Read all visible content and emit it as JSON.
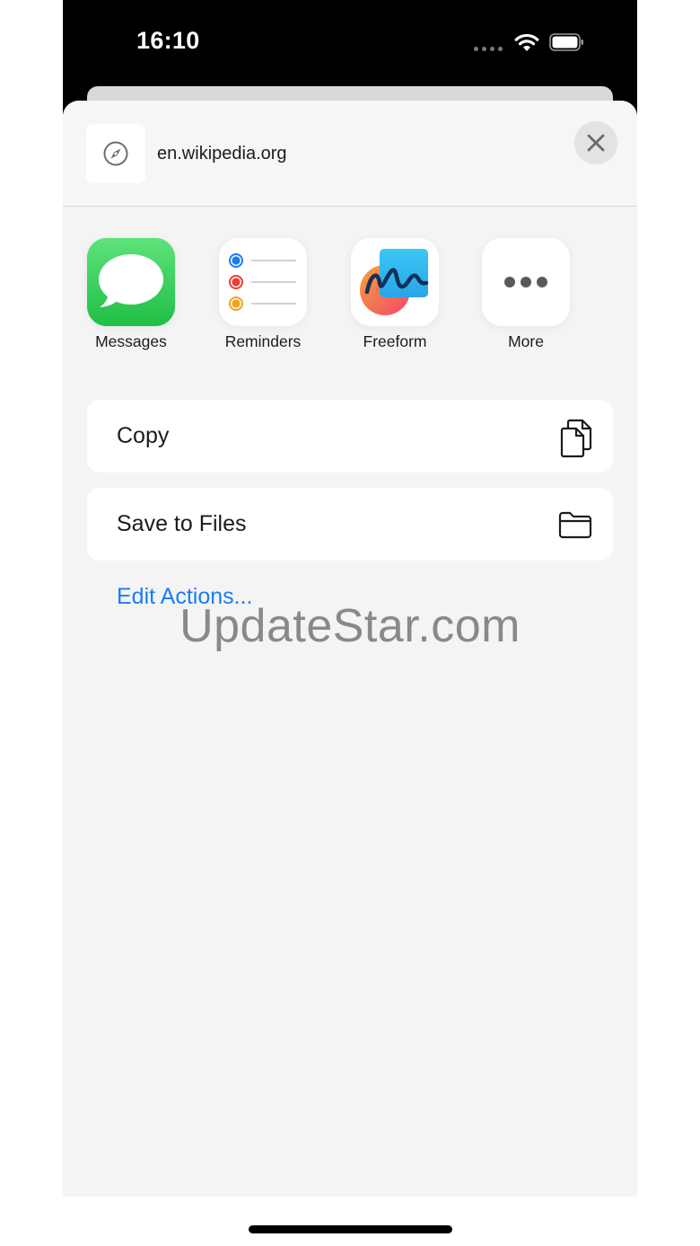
{
  "status_bar": {
    "time": "16:10"
  },
  "share_sheet": {
    "url": "en.wikipedia.org",
    "close_icon": "close-icon",
    "apps": [
      {
        "label": "Messages",
        "icon": "messages-app-icon"
      },
      {
        "label": "Reminders",
        "icon": "reminders-app-icon"
      },
      {
        "label": "Freeform",
        "icon": "freeform-app-icon"
      },
      {
        "label": "More",
        "icon": "more-icon"
      }
    ],
    "actions": [
      {
        "label": "Copy",
        "icon": "copy-icon"
      },
      {
        "label": "Save to Files",
        "icon": "folder-icon"
      }
    ],
    "edit_actions": "Edit Actions..."
  },
  "watermark": "UpdateStar.com",
  "colors": {
    "accent": "#1a7cf2",
    "messages_green": "#33c95a",
    "sheet_background": "#f4f4f4"
  }
}
